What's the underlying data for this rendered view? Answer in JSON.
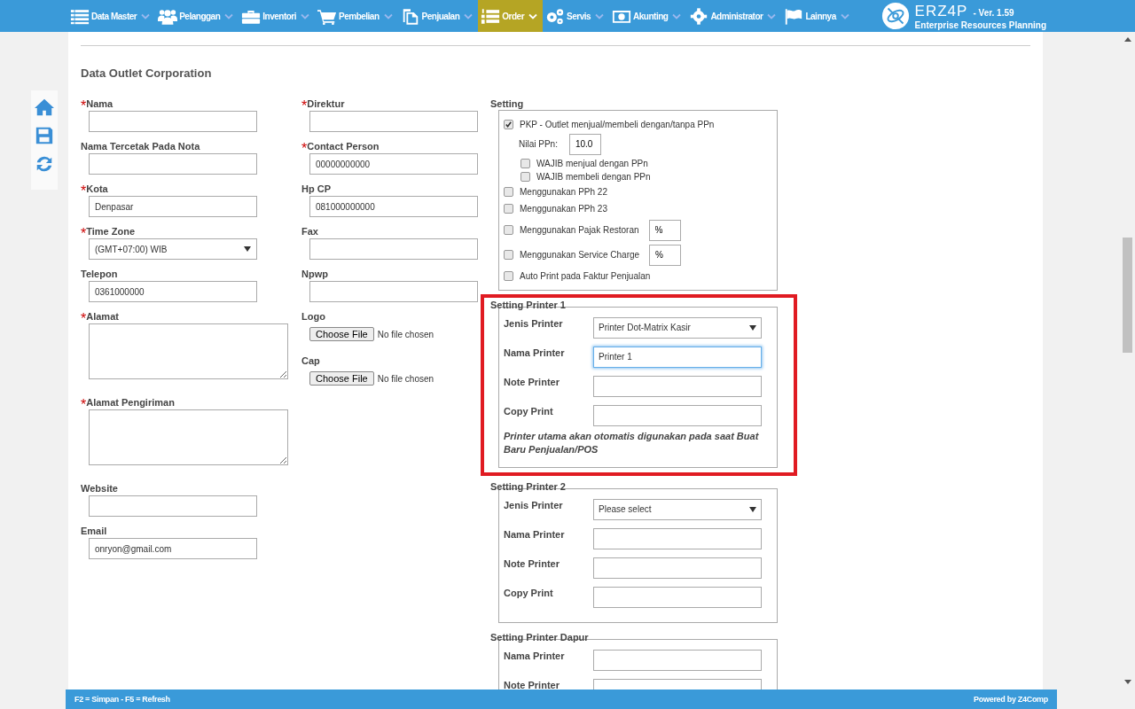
{
  "nav": {
    "items": [
      {
        "label": "Data Master",
        "kind": "list",
        "selected": false
      },
      {
        "label": "Pelanggan",
        "kind": "users",
        "selected": false
      },
      {
        "label": "Inventori",
        "kind": "briefcase",
        "selected": false
      },
      {
        "label": "Pembelian",
        "kind": "cart",
        "selected": false
      },
      {
        "label": "Penjualan",
        "kind": "document",
        "selected": false
      },
      {
        "label": "Order",
        "kind": "numbered",
        "selected": true
      },
      {
        "label": "Servis",
        "kind": "gears",
        "selected": false
      },
      {
        "label": "Akunting",
        "kind": "money",
        "selected": false
      },
      {
        "label": "Administrator",
        "kind": "gear",
        "selected": false
      },
      {
        "label": "Lainnya",
        "kind": "flag",
        "selected": false
      }
    ],
    "brand": {
      "name": "ERZ4P",
      "version": "- Ver. 1.59",
      "tagline": "Enterprise Resources Planning"
    }
  },
  "side_tools": [
    {
      "kind": "home"
    },
    {
      "kind": "save"
    },
    {
      "kind": "refresh"
    }
  ],
  "form": {
    "title": "Data Outlet Corporation",
    "left_fields": [
      {
        "mark": "*",
        "label": "Nama",
        "kind": "text"
      },
      {
        "label": "Nama Tercetak Pada Nota",
        "kind": "text"
      },
      {
        "mark": "*",
        "label": "Kota",
        "kind": "text",
        "value": "Denpasar"
      },
      {
        "mark": "*",
        "label": "Time Zone",
        "kind": "select",
        "value": "(GMT+07:00) WIB"
      },
      {
        "label": "Telepon",
        "kind": "text",
        "value": "0361000000"
      },
      {
        "mark": "*",
        "label": "Alamat",
        "kind": "textarea"
      },
      {
        "mark": "*",
        "label": "Alamat Pengiriman",
        "kind": "textarea"
      },
      {
        "label": "Website",
        "kind": "text"
      },
      {
        "label": "Email",
        "kind": "text",
        "value": "onryon@gmail.com"
      }
    ],
    "middle_fields": [
      {
        "mark": "*",
        "label": "Direktur",
        "kind": "text"
      },
      {
        "mark": "*",
        "label": "Contact Person",
        "kind": "text",
        "value": "00000000000"
      },
      {
        "label": "Hp CP",
        "kind": "text",
        "value": "081000000000"
      },
      {
        "label": "Fax",
        "kind": "text"
      },
      {
        "label": "Npwp",
        "kind": "text"
      },
      {
        "label": "Logo",
        "kind": "file",
        "button": "Choose File",
        "status": "No file chosen"
      },
      {
        "label": "Cap",
        "kind": "file",
        "button": "Choose File",
        "status": "No file chosen"
      }
    ],
    "settings": {
      "title": "Setting",
      "options": [
        {
          "kind": "checkbox",
          "label": "PKP - Outlet menjual/membeli dengan/tanpa PPn",
          "checked": true,
          "children": [
            {
              "kind": "field",
              "label": "Nilai PPn:",
              "value": "10.0"
            },
            {
              "kind": "checkbox",
              "label": "WAJIB menjual dengan PPn",
              "checked": false
            },
            {
              "kind": "checkbox",
              "label": "WAJIB membeli dengan PPn",
              "checked": false
            }
          ]
        },
        {
          "kind": "checkbox",
          "label": "Menggunakan PPh 22",
          "checked": false
        },
        {
          "kind": "checkbox",
          "label": "Menggunakan PPh 23",
          "checked": false
        },
        {
          "kind": "checkbox",
          "label": "Menggunakan Pajak Restoran",
          "checked": false,
          "value": "%"
        },
        {
          "kind": "checkbox",
          "label": "Menggunakan Service Charge",
          "checked": false,
          "value": "%"
        },
        {
          "kind": "checkbox",
          "label": "Auto Print pada Faktur Penjualan",
          "checked": false
        }
      ]
    },
    "printers": [
      {
        "title": "Setting Printer 1",
        "highlighted": true,
        "fields": [
          {
            "label": "Jenis Printer",
            "kind": "select",
            "value": "Printer Dot-Matrix Kasir",
            "focused": false
          },
          {
            "label": "Nama Printer",
            "kind": "text",
            "value": "Printer 1",
            "focused": true
          },
          {
            "label": "Note Printer",
            "kind": "text",
            "focused": false
          },
          {
            "label": "Copy Print",
            "kind": "text",
            "focused": false
          }
        ],
        "note": "Printer utama akan otomatis digunakan pada saat Buat Baru Penjualan/POS"
      },
      {
        "title": "Setting Printer 2",
        "highlighted": false,
        "fields": [
          {
            "label": "Jenis Printer",
            "kind": "select",
            "value": "Please select",
            "focused": false
          },
          {
            "label": "Nama Printer",
            "kind": "text",
            "focused": false
          },
          {
            "label": "Note Printer",
            "kind": "text",
            "focused": false
          },
          {
            "label": "Copy Print",
            "kind": "text",
            "focused": false
          }
        ]
      },
      {
        "title": "Setting Printer Dapur",
        "highlighted": false,
        "fields": [
          {
            "label": "Nama Printer",
            "kind": "text",
            "focused": false
          },
          {
            "label": "Note Printer",
            "kind": "text",
            "focused": false
          }
        ]
      }
    ]
  },
  "footer": {
    "shortcuts": "F2 = Simpan - F5 = Refresh",
    "credit": "Powered by Z4Comp"
  }
}
